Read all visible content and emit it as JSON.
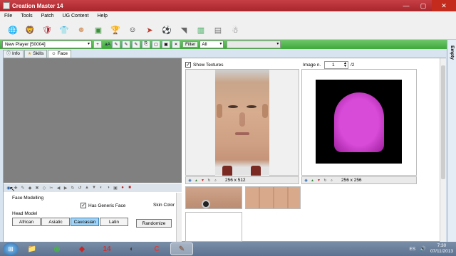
{
  "window": {
    "title": "Creation Master 14",
    "minimize": "—",
    "maximize": "▢",
    "close": "✕"
  },
  "menu": [
    "File",
    "Tools",
    "Patch",
    "UG Content",
    "Help"
  ],
  "toolbar_icons": [
    {
      "name": "globe-icon",
      "glyph": "🌐",
      "color": "#2a6fc0"
    },
    {
      "name": "league-icon",
      "glyph": "🦁",
      "color": "#4b2b7f"
    },
    {
      "name": "club-crest-icon",
      "glyph": "🛡",
      "color": "#a3212e"
    },
    {
      "name": "kit-icon",
      "glyph": "👕",
      "color": "#c9302c"
    },
    {
      "name": "player-face-icon",
      "glyph": "☻",
      "color": "#d9a074"
    },
    {
      "name": "stadium-icon",
      "glyph": "▣",
      "color": "#3a8f3a"
    },
    {
      "name": "trophy-icon",
      "glyph": "🏆",
      "color": "#d4a017"
    },
    {
      "name": "referee-icon",
      "glyph": "☺",
      "color": "#222222"
    },
    {
      "name": "shoe-icon",
      "glyph": "➤",
      "color": "#c0392b"
    },
    {
      "name": "ball-icon",
      "glyph": "⚽",
      "color": "#333333"
    },
    {
      "name": "boots-icon",
      "glyph": "◥",
      "color": "#666666"
    },
    {
      "name": "pitch-icon",
      "glyph": "▥",
      "color": "#2ea44f"
    },
    {
      "name": "newspaper-icon",
      "glyph": "▤",
      "color": "#777777"
    },
    {
      "name": "mascot-icon",
      "glyph": "☃",
      "color": "#5a5a5a"
    }
  ],
  "player_bar": {
    "selected_player": "New Player [50004]",
    "add_label": "aA",
    "filter_label": "Filter",
    "filter_value": "All"
  },
  "side_strip_label": "Empty",
  "tabs": [
    {
      "label": "Info",
      "icon": "info-icon",
      "glyph": "ⓘ"
    },
    {
      "label": "Skills",
      "icon": "star-icon",
      "glyph": "★"
    },
    {
      "label": "Face",
      "icon": "face-icon",
      "glyph": "☺"
    }
  ],
  "face_panel": {
    "section_title": "Face Modelling",
    "generic_face_label": "Has Generic Face",
    "generic_face_checked": true,
    "skin_color_label": "Skin Color",
    "head_model_label": "Head Model",
    "head_models": [
      "African",
      "Asiatic",
      "Caucasian",
      "Latin"
    ],
    "selected_head_model": "Caucasian",
    "randomize_label": "Randomize"
  },
  "textures": {
    "show_textures_label": "Show Textures",
    "show_textures_checked": true,
    "image_n_label": "Image n.",
    "image_n_value": "1",
    "image_total": "/2",
    "texture1_size": "256 x 512",
    "texture2_size": "256 x 256"
  },
  "taskbar": {
    "items": [
      {
        "name": "explorer-icon",
        "glyph": "📁",
        "color": "#f0c040"
      },
      {
        "name": "chrome-icon",
        "glyph": "◉",
        "color": "#4caf50"
      },
      {
        "name": "app-red-icon",
        "glyph": "◆",
        "color": "#c62828"
      },
      {
        "name": "fifa14-icon",
        "glyph": "14",
        "color": "#d32f2f"
      },
      {
        "name": "media-icon",
        "glyph": "◐",
        "color": "#444444"
      },
      {
        "name": "creation-master-icon",
        "glyph": "C",
        "color": "#e53935"
      },
      {
        "name": "creation-master-active-icon",
        "glyph": "✎",
        "color": "#8d6e63"
      }
    ],
    "language": "ES",
    "time": "7:30",
    "date": "07/11/2013"
  }
}
